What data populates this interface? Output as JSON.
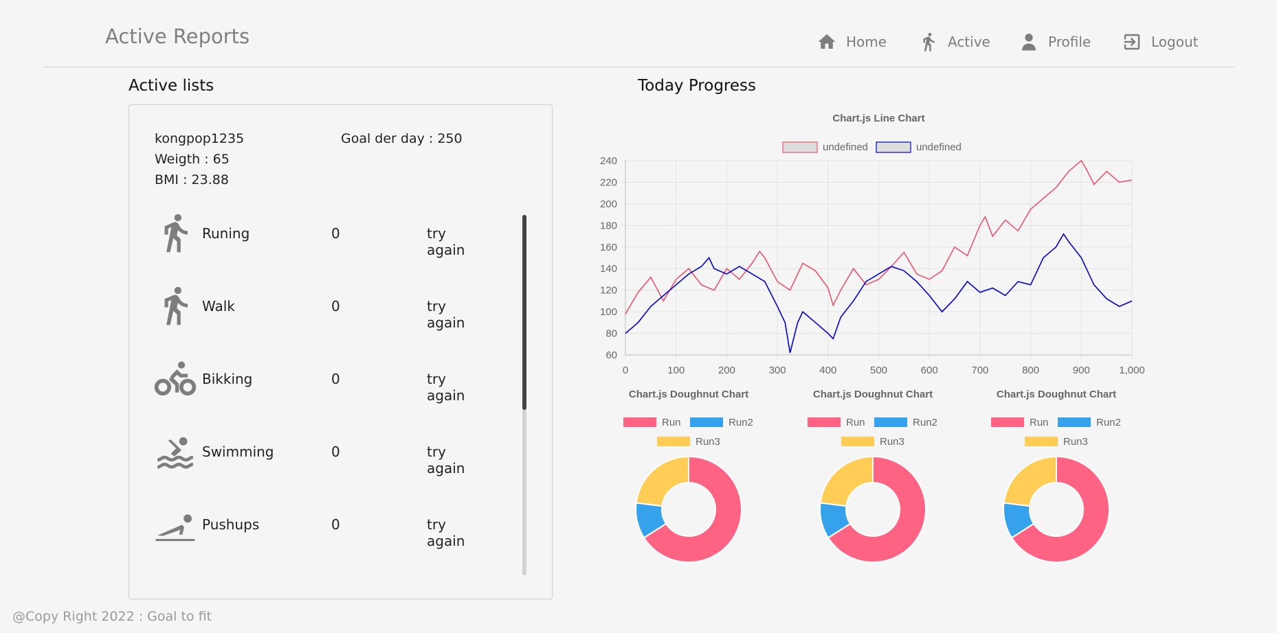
{
  "header": {
    "brand": "Active Reports",
    "nav": [
      {
        "label": "Home",
        "icon": "home-icon"
      },
      {
        "label": "Active",
        "icon": "running-icon"
      },
      {
        "label": "Profile",
        "icon": "person-icon"
      },
      {
        "label": "Logout",
        "icon": "logout-icon"
      }
    ]
  },
  "active_lists": {
    "heading": "Active lists",
    "username": "kongpop1235",
    "goal": "Goal der day : 250",
    "weight": "Weigth : 65",
    "bmi": "BMI : 23.88",
    "items": [
      {
        "name": "Runing",
        "count": "0",
        "status": "try again",
        "icon": "running-icon"
      },
      {
        "name": "Walk",
        "count": "0",
        "status": "try again",
        "icon": "walking-icon"
      },
      {
        "name": "Bikking",
        "count": "0",
        "status": "try again",
        "icon": "bike-icon"
      },
      {
        "name": "Swimming",
        "count": "0",
        "status": "try again",
        "icon": "swimming-icon"
      },
      {
        "name": "Pushups",
        "count": "0",
        "status": "try again",
        "icon": "pushup-icon"
      }
    ],
    "scroll_fraction": 0.54
  },
  "progress": {
    "heading": "Today Progress"
  },
  "footer": "@Copy Right 2022 : Goal to fit",
  "colors": {
    "red": "#ff6384",
    "blue": "#36a2eb",
    "yellow": "#ffcd56",
    "line_red": "#e9546c",
    "line_blue": "#0000cc"
  },
  "chart_data": [
    {
      "type": "line",
      "title": "Chart.js Line Chart",
      "legend": [
        "undefined",
        "undefined"
      ],
      "legend_position": "top",
      "grid": true,
      "xlim": [
        0,
        1000
      ],
      "ylim": [
        60,
        240
      ],
      "xticks": [
        "0",
        "100",
        "200",
        "300",
        "400",
        "500",
        "600",
        "700",
        "800",
        "900",
        "1,000"
      ],
      "yticks": [
        "60",
        "80",
        "100",
        "120",
        "140",
        "160",
        "180",
        "200",
        "220",
        "240"
      ],
      "series": [
        {
          "color": "#e9546c",
          "x": [
            0,
            25,
            50,
            75,
            100,
            125,
            150,
            175,
            200,
            225,
            250,
            265,
            275,
            300,
            325,
            350,
            375,
            400,
            410,
            425,
            450,
            475,
            500,
            525,
            550,
            575,
            600,
            625,
            650,
            675,
            700,
            710,
            725,
            750,
            775,
            800,
            825,
            850,
            875,
            900,
            910,
            925,
            950,
            975,
            1000
          ],
          "y": [
            98,
            118,
            132,
            110,
            130,
            140,
            125,
            120,
            140,
            130,
            145,
            156,
            150,
            128,
            120,
            145,
            138,
            122,
            106,
            120,
            140,
            125,
            130,
            142,
            155,
            135,
            130,
            138,
            160,
            152,
            180,
            188,
            170,
            185,
            175,
            195,
            205,
            215,
            230,
            240,
            232,
            218,
            230,
            220,
            222
          ]
        },
        {
          "color": "#0000cc",
          "x": [
            0,
            25,
            50,
            75,
            100,
            125,
            150,
            165,
            175,
            200,
            225,
            250,
            275,
            300,
            315,
            325,
            340,
            350,
            375,
            400,
            410,
            425,
            450,
            475,
            500,
            525,
            550,
            575,
            600,
            625,
            650,
            675,
            700,
            725,
            750,
            775,
            800,
            825,
            850,
            865,
            875,
            900,
            925,
            950,
            975,
            1000
          ],
          "y": [
            80,
            90,
            105,
            115,
            125,
            135,
            142,
            150,
            140,
            135,
            142,
            135,
            128,
            105,
            90,
            62,
            90,
            100,
            90,
            80,
            75,
            95,
            110,
            128,
            135,
            142,
            138,
            128,
            115,
            100,
            112,
            128,
            118,
            122,
            115,
            128,
            125,
            150,
            160,
            172,
            165,
            150,
            125,
            112,
            105,
            110
          ]
        }
      ]
    },
    {
      "type": "pie",
      "title": "Chart.js Doughnut Chart",
      "legend": [
        "Run",
        "Run2",
        "Run3"
      ],
      "values": [
        66,
        11,
        23
      ]
    },
    {
      "type": "pie",
      "title": "Chart.js Doughnut Chart",
      "legend": [
        "Run",
        "Run2",
        "Run3"
      ],
      "values": [
        66,
        11,
        23
      ]
    },
    {
      "type": "pie",
      "title": "Chart.js Doughnut Chart",
      "legend": [
        "Run",
        "Run2",
        "Run3"
      ],
      "values": [
        66,
        11,
        23
      ]
    }
  ]
}
